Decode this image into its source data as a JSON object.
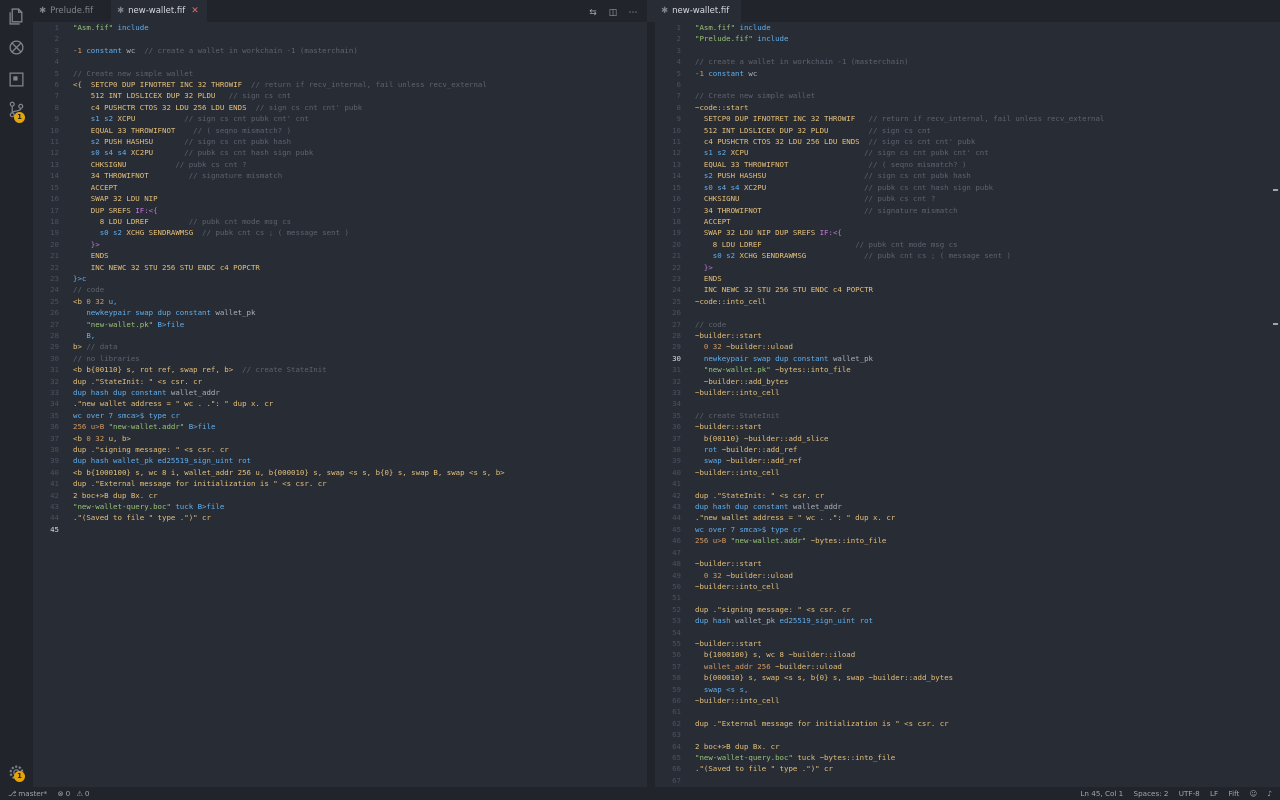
{
  "activity_bar": {
    "scm_badge": "1",
    "settings_badge": "1"
  },
  "left_editor": {
    "tabs": [
      {
        "label": "Prelude.fif",
        "active": false
      },
      {
        "label": "new-wallet.fif",
        "active": true
      }
    ],
    "current_line": 45,
    "lines": [
      [
        [
          "\"Asm.fif\"",
          "str"
        ],
        [
          " include",
          "kw"
        ]
      ],
      [],
      [
        [
          "-1",
          "num"
        ],
        [
          " constant",
          "kw"
        ],
        [
          " wc  ",
          ""
        ],
        [
          "// create a wallet in workchain -1 (masterchain)",
          "com"
        ]
      ],
      [],
      [
        [
          "// Create new simple wallet",
          "com"
        ]
      ],
      [
        [
          "<{  ",
          "op"
        ],
        [
          "SETCP0 DUP IFNOTRET INC 32 THROWIF",
          "op"
        ],
        [
          "  // return if recv_internal, fail unless recv_external",
          "com"
        ]
      ],
      [
        [
          "    512 INT LDSLICEX DUP 32 PLDU",
          "op"
        ],
        [
          "   // sign cs cnt",
          "com"
        ]
      ],
      [
        [
          "    c4 PUSHCTR CTOS 32 LDU 256 LDU ENDS",
          "op"
        ],
        [
          "  // sign cs cnt cnt' pubk",
          "com"
        ]
      ],
      [
        [
          "    s1 s2 ",
          "kw"
        ],
        [
          "XCPU",
          "op"
        ],
        [
          "           // sign cs cnt pubk cnt' cnt",
          "com"
        ]
      ],
      [
        [
          "    EQUAL 33 THROWIFNOT",
          "op"
        ],
        [
          "    // ( seqno mismatch? )",
          "com"
        ]
      ],
      [
        [
          "    s2 ",
          "kw"
        ],
        [
          "PUSH HASHSU",
          "op"
        ],
        [
          "       // sign cs cnt pubk hash",
          "com"
        ]
      ],
      [
        [
          "    s0 s4 s4 ",
          "kw"
        ],
        [
          "XC2PU",
          "op"
        ],
        [
          "       // pubk cs cnt hash sign pubk",
          "com"
        ]
      ],
      [
        [
          "    CHKSIGNU",
          "op"
        ],
        [
          "           // pubk cs cnt ?",
          "com"
        ]
      ],
      [
        [
          "    34 THROWIFNOT",
          "op"
        ],
        [
          "         // signature mismatch",
          "com"
        ]
      ],
      [
        [
          "    ACCEPT",
          "op"
        ]
      ],
      [
        [
          "    SWAP 32 LDU NIP",
          "op"
        ]
      ],
      [
        [
          "    DUP SREFS ",
          "op"
        ],
        [
          "IF:<{",
          "fn"
        ]
      ],
      [
        [
          "      8 LDU LDREF",
          "op"
        ],
        [
          "         // pubk cnt mode msg cs",
          "com"
        ]
      ],
      [
        [
          "      s0 s2 ",
          "kw"
        ],
        [
          "XCHG SENDRAWMSG",
          "op"
        ],
        [
          "  // pubk cnt cs ; ( message sent )",
          "com"
        ]
      ],
      [
        [
          "    }>",
          "fn"
        ]
      ],
      [
        [
          "    ENDS",
          "op"
        ]
      ],
      [
        [
          "    INC NEWC 32 STU 256 STU ENDC c4 POPCTR",
          "op"
        ]
      ],
      [
        [
          "}>c",
          "kw"
        ]
      ],
      [
        [
          "// code",
          "com"
        ]
      ],
      [
        [
          "<b ",
          "op"
        ],
        [
          "0 32 ",
          "num"
        ],
        [
          "u,",
          "kw"
        ]
      ],
      [
        [
          "   newkeypair swap dup constant ",
          "kw"
        ],
        [
          "wallet_pk",
          ""
        ]
      ],
      [
        [
          "   \"new-wallet.pk\"",
          "str"
        ],
        [
          " B>file",
          "kw"
        ]
      ],
      [
        [
          "   B,",
          "kw"
        ]
      ],
      [
        [
          "b> ",
          "op"
        ],
        [
          "// data",
          "com"
        ]
      ],
      [
        [
          "// no libraries",
          "com"
        ]
      ],
      [
        [
          "<b b{00110} s, rot ref, swap ref, b>",
          "op"
        ],
        [
          "  // create StateInit",
          "com"
        ]
      ],
      [
        [
          "dup .\"StateInit: \" <s csr. cr",
          "op"
        ]
      ],
      [
        [
          "dup hash dup constant ",
          "kw"
        ],
        [
          "wallet_addr",
          ""
        ]
      ],
      [
        [
          ".\"new wallet address = \" wc . .\": \" dup x. cr",
          "op"
        ]
      ],
      [
        [
          "wc over 7 smca>$ type cr",
          "kw"
        ]
      ],
      [
        [
          "256 u>B ",
          "num"
        ],
        [
          "\"new-wallet.addr\"",
          "str"
        ],
        [
          " B>file",
          "kw"
        ]
      ],
      [
        [
          "<b ",
          "op"
        ],
        [
          "0 32 ",
          "num"
        ],
        [
          "u, b>",
          "op"
        ]
      ],
      [
        [
          "dup .\"signing message: \" <s csr. cr",
          "op"
        ]
      ],
      [
        [
          "dup hash wallet_pk ",
          "kw"
        ],
        [
          "ed25519_sign_uint rot",
          "kw"
        ]
      ],
      [
        [
          "<b b{1000100} s, wc 8 i, wallet_addr 256 u, b{000010} s, swap <s s, b{0} s, swap B, swap <s s, b>",
          "op"
        ]
      ],
      [
        [
          "dup .\"External message for initialization is \" <s csr. cr",
          "op"
        ]
      ],
      [
        [
          "2 boc+>B dup Bx. cr",
          "op"
        ]
      ],
      [
        [
          "\"new-wallet-query.boc\"",
          "str"
        ],
        [
          " tuck B>file",
          "kw"
        ]
      ],
      [
        [
          ".\"(Saved to file \" type .\")\" cr",
          "op"
        ]
      ],
      []
    ]
  },
  "right_editor": {
    "tabs": [
      {
        "label": "new-wallet.fif",
        "active": true
      }
    ],
    "current_line": 30,
    "lines": [
      [
        [
          "\"Asm.fif\"",
          "str"
        ],
        [
          " include",
          "kw"
        ]
      ],
      [
        [
          "\"Prelude.fif\"",
          "str"
        ],
        [
          " include",
          "kw"
        ]
      ],
      [],
      [
        [
          "// create a wallet in workchain -1 (masterchain)",
          "com"
        ]
      ],
      [
        [
          "-1",
          "num"
        ],
        [
          " constant ",
          "kw"
        ],
        [
          "wc",
          ""
        ]
      ],
      [],
      [
        [
          "// Create new simple wallet",
          "com"
        ]
      ],
      [
        [
          "~code::start",
          "op"
        ]
      ],
      [
        [
          "  SETCP0 DUP IFNOTRET INC 32 THROWIF",
          "op"
        ],
        [
          "   // return if recv_internal, fail unless recv_external",
          "com"
        ]
      ],
      [
        [
          "  512 INT LDSLICEX DUP 32 PLDU",
          "op"
        ],
        [
          "         // sign cs cnt",
          "com"
        ]
      ],
      [
        [
          "  c4 PUSHCTR CTOS 32 LDU 256 LDU ENDS",
          "op"
        ],
        [
          "  // sign cs cnt cnt' pubk",
          "com"
        ]
      ],
      [
        [
          "  s1 s2 ",
          "kw"
        ],
        [
          "XCPU",
          "op"
        ],
        [
          "                          // sign cs cnt pubk cnt' cnt",
          "com"
        ]
      ],
      [
        [
          "  EQUAL 33 THROWIFNOT",
          "op"
        ],
        [
          "                  // ( seqno mismatch? )",
          "com"
        ]
      ],
      [
        [
          "  s2 ",
          "kw"
        ],
        [
          "PUSH HASHSU",
          "op"
        ],
        [
          "                      // sign cs cnt pubk hash",
          "com"
        ]
      ],
      [
        [
          "  s0 s4 s4 ",
          "kw"
        ],
        [
          "XC2PU",
          "op"
        ],
        [
          "                      // pubk cs cnt hash sign pubk",
          "com"
        ]
      ],
      [
        [
          "  CHKSIGNU",
          "op"
        ],
        [
          "                            // pubk cs cnt ?",
          "com"
        ]
      ],
      [
        [
          "  34 THROWIFNOT",
          "op"
        ],
        [
          "                       // signature mismatch",
          "com"
        ]
      ],
      [
        [
          "  ACCEPT",
          "op"
        ]
      ],
      [
        [
          "  SWAP 32 LDU NIP DUP SREFS ",
          "op"
        ],
        [
          "IF:<{",
          "fn"
        ]
      ],
      [
        [
          "    8 LDU LDREF",
          "op"
        ],
        [
          "                     // pubk cnt mode msg cs",
          "com"
        ]
      ],
      [
        [
          "    s0 s2 ",
          "kw"
        ],
        [
          "XCHG SENDRAWMSG",
          "op"
        ],
        [
          "             // pubk cnt cs ; ( message sent )",
          "com"
        ]
      ],
      [
        [
          "  }>",
          "fn"
        ]
      ],
      [
        [
          "  ENDS",
          "op"
        ]
      ],
      [
        [
          "  INC NEWC 32 STU 256 STU ENDC c4 POPCTR",
          "op"
        ]
      ],
      [
        [
          "~code::into_cell",
          "op"
        ]
      ],
      [],
      [
        [
          "// code",
          "com"
        ]
      ],
      [
        [
          "~builder::start",
          "op"
        ]
      ],
      [
        [
          "  0 32 ",
          "num"
        ],
        [
          "~builder::uload",
          "op"
        ]
      ],
      [
        [
          "  newkeypair swap dup constant ",
          "kw"
        ],
        [
          "wallet_pk",
          ""
        ]
      ],
      [
        [
          "  \"new-wallet.pk\"",
          "str"
        ],
        [
          " ~bytes::into_file",
          "op"
        ]
      ],
      [
        [
          "  ~builder::add_bytes",
          "op"
        ]
      ],
      [
        [
          "~builder::into_cell",
          "op"
        ]
      ],
      [],
      [
        [
          "// create StateInit",
          "com"
        ]
      ],
      [
        [
          "~builder::start",
          "op"
        ]
      ],
      [
        [
          "  b{00110} ",
          "op"
        ],
        [
          "~builder::add_slice",
          "op"
        ]
      ],
      [
        [
          "  rot ",
          "kw"
        ],
        [
          "~builder::add_ref",
          "op"
        ]
      ],
      [
        [
          "  swap ",
          "kw"
        ],
        [
          "~builder::add_ref",
          "op"
        ]
      ],
      [
        [
          "~builder::into_cell",
          "op"
        ]
      ],
      [],
      [
        [
          "dup .\"StateInit: \" <s csr. cr",
          "op"
        ]
      ],
      [
        [
          "dup hash dup constant ",
          "kw"
        ],
        [
          "wallet_addr",
          ""
        ]
      ],
      [
        [
          ".\"new wallet address = \" wc . .\": \" dup x. cr",
          "op"
        ]
      ],
      [
        [
          "wc over 7 smca>$ type cr",
          "kw"
        ]
      ],
      [
        [
          "256 u>B ",
          "num"
        ],
        [
          "\"new-wallet.addr\"",
          "str"
        ],
        [
          " ~bytes::into_file",
          "op"
        ]
      ],
      [],
      [
        [
          "~builder::start",
          "op"
        ]
      ],
      [
        [
          "  0 32 ",
          "num"
        ],
        [
          "~builder::uload",
          "op"
        ]
      ],
      [
        [
          "~builder::into_cell",
          "op"
        ]
      ],
      [],
      [
        [
          "dup .\"signing message: \" <s csr. cr",
          "op"
        ]
      ],
      [
        [
          "dup hash ",
          "kw"
        ],
        [
          "wallet_pk",
          ""
        ],
        [
          " ed25519_sign_uint rot",
          "kw"
        ]
      ],
      [],
      [
        [
          "~builder::start",
          "op"
        ]
      ],
      [
        [
          "  b{1000100} s, wc 8 ",
          "op"
        ],
        [
          "~builder::iload",
          "op"
        ]
      ],
      [
        [
          "  wallet_addr 256 ",
          "num"
        ],
        [
          "~builder::uload",
          "op"
        ]
      ],
      [
        [
          "  b{000010} s, swap <s s, b{0} s, swap ",
          "op"
        ],
        [
          "~builder::add_bytes",
          "op"
        ]
      ],
      [
        [
          "  swap <s s,",
          "kw"
        ]
      ],
      [
        [
          "~builder::into_cell",
          "op"
        ]
      ],
      [],
      [
        [
          "dup .\"External message for initialization is \" <s csr. cr",
          "op"
        ]
      ],
      [],
      [
        [
          "2 boc+>B dup Bx. cr",
          "op"
        ]
      ],
      [
        [
          "\"new-wallet-query.boc\"",
          "str"
        ],
        [
          " tuck ~bytes::into_file",
          "op"
        ]
      ],
      [
        [
          ".\"(Saved to file \" type .\")\" cr",
          "op"
        ]
      ],
      []
    ]
  },
  "status_bar": {
    "branch": "master*",
    "errors": "0",
    "warnings": "0",
    "position": "Ln 45, Col 1",
    "spaces": "Spaces: 2",
    "encoding": "UTF-8",
    "eol": "LF",
    "language": "Fift"
  }
}
